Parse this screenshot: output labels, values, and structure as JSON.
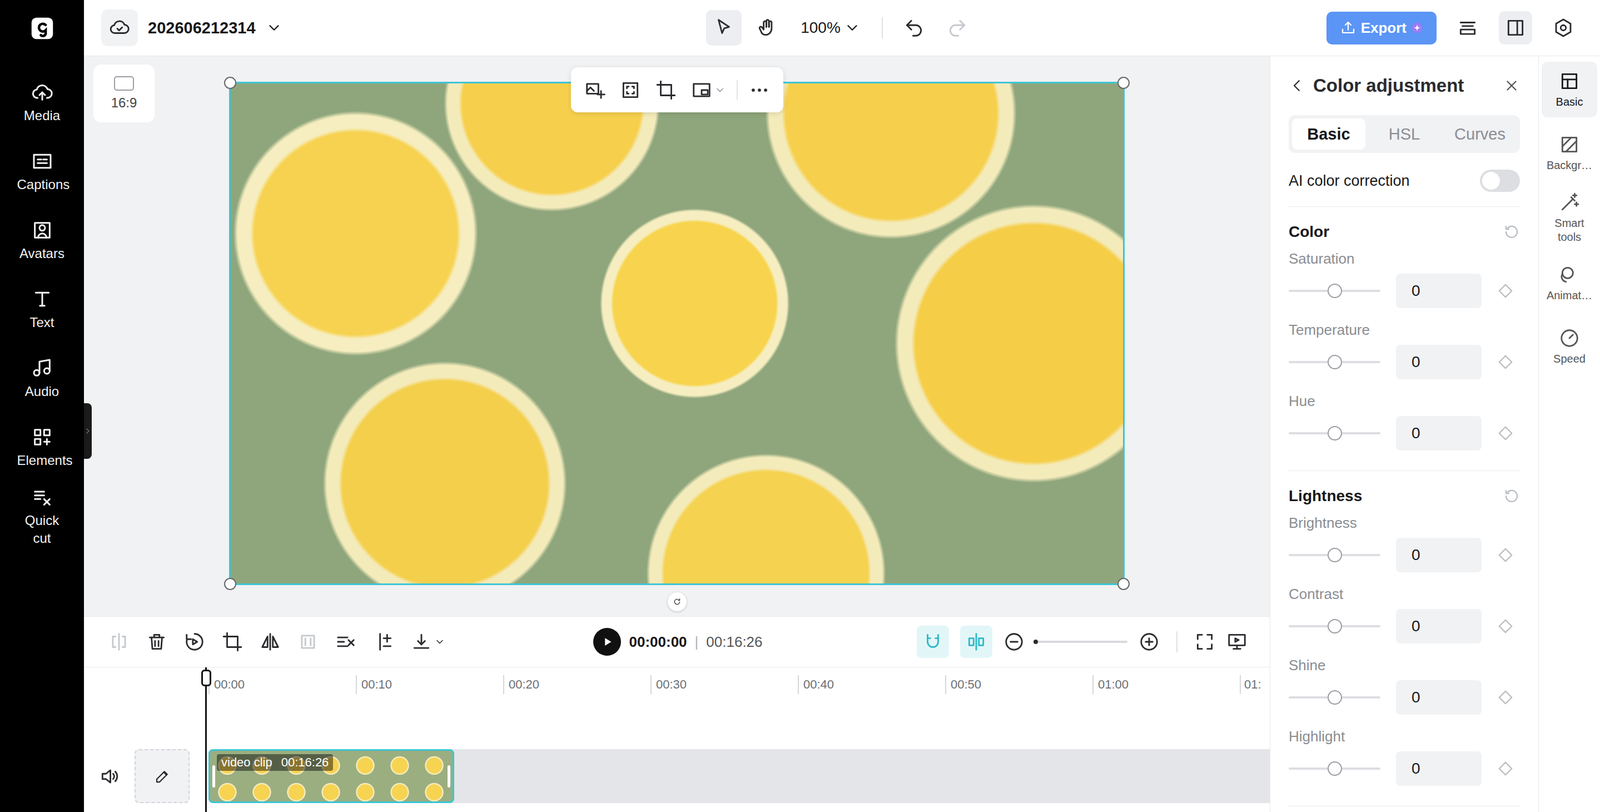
{
  "project": {
    "name": "202606212314"
  },
  "sidebar": {
    "items": [
      {
        "label": "Media"
      },
      {
        "label": "Captions"
      },
      {
        "label": "Avatars"
      },
      {
        "label": "Text"
      },
      {
        "label": "Audio"
      },
      {
        "label": "Elements"
      },
      {
        "label": "Quick cut"
      }
    ]
  },
  "topbar": {
    "tools": [
      {
        "selected": true
      },
      {
        "selected": false
      }
    ],
    "zoom": "100%",
    "undo": {
      "disabled": false
    },
    "redo": {
      "disabled": true
    },
    "export": "Export"
  },
  "canvas": {
    "aspect": "16:9"
  },
  "player": {
    "playing": false,
    "current": "00:00:00",
    "separator": "|",
    "duration": "00:16:26"
  },
  "timeline_tools": {
    "left": [
      {
        "disabled": true
      },
      {
        "disabled": false
      },
      {
        "disabled": false
      },
      {
        "disabled": false
      },
      {
        "disabled": false
      },
      {
        "disabled": true
      },
      {
        "disabled": false
      },
      {
        "disabled": false
      },
      {
        "disabled": false
      }
    ],
    "toggles": [
      {
        "on": true
      },
      {
        "on": true
      }
    ],
    "zoom": {
      "level": 0
    }
  },
  "timeline": {
    "ruler": [
      "00:00",
      "00:10",
      "00:20",
      "00:30",
      "00:40",
      "00:50",
      "01:00",
      "01:"
    ],
    "clip": {
      "label": "video clip",
      "duration": "00:16:26",
      "selected": true
    }
  },
  "panel": {
    "title": "Color adjustment",
    "tabs": [
      {
        "label": "Basic",
        "selected": true
      },
      {
        "label": "HSL",
        "selected": false
      },
      {
        "label": "Curves",
        "selected": false
      }
    ],
    "ai_correction": {
      "label": "AI color correction",
      "on": false
    },
    "sections": [
      {
        "title": "Color",
        "rows": [
          {
            "label": "Saturation",
            "value": "0",
            "level": 0.5
          },
          {
            "label": "Temperature",
            "value": "0",
            "level": 0.5
          },
          {
            "label": "Hue",
            "value": "0",
            "level": 0.5
          }
        ]
      },
      {
        "title": "Lightness",
        "rows": [
          {
            "label": "Brightness",
            "value": "0",
            "level": 0.5
          },
          {
            "label": "Contrast",
            "value": "0",
            "level": 0.5
          },
          {
            "label": "Shine",
            "value": "0",
            "level": 0.5
          },
          {
            "label": "Highlight",
            "value": "0",
            "level": 0.5
          }
        ]
      }
    ]
  },
  "side_tabs": [
    {
      "label": "Basic",
      "selected": true
    },
    {
      "label": "Backgr…",
      "selected": false
    },
    {
      "label": "Smart tools",
      "selected": false
    },
    {
      "label": "Animat…",
      "selected": false
    },
    {
      "label": "Speed",
      "selected": false
    }
  ]
}
